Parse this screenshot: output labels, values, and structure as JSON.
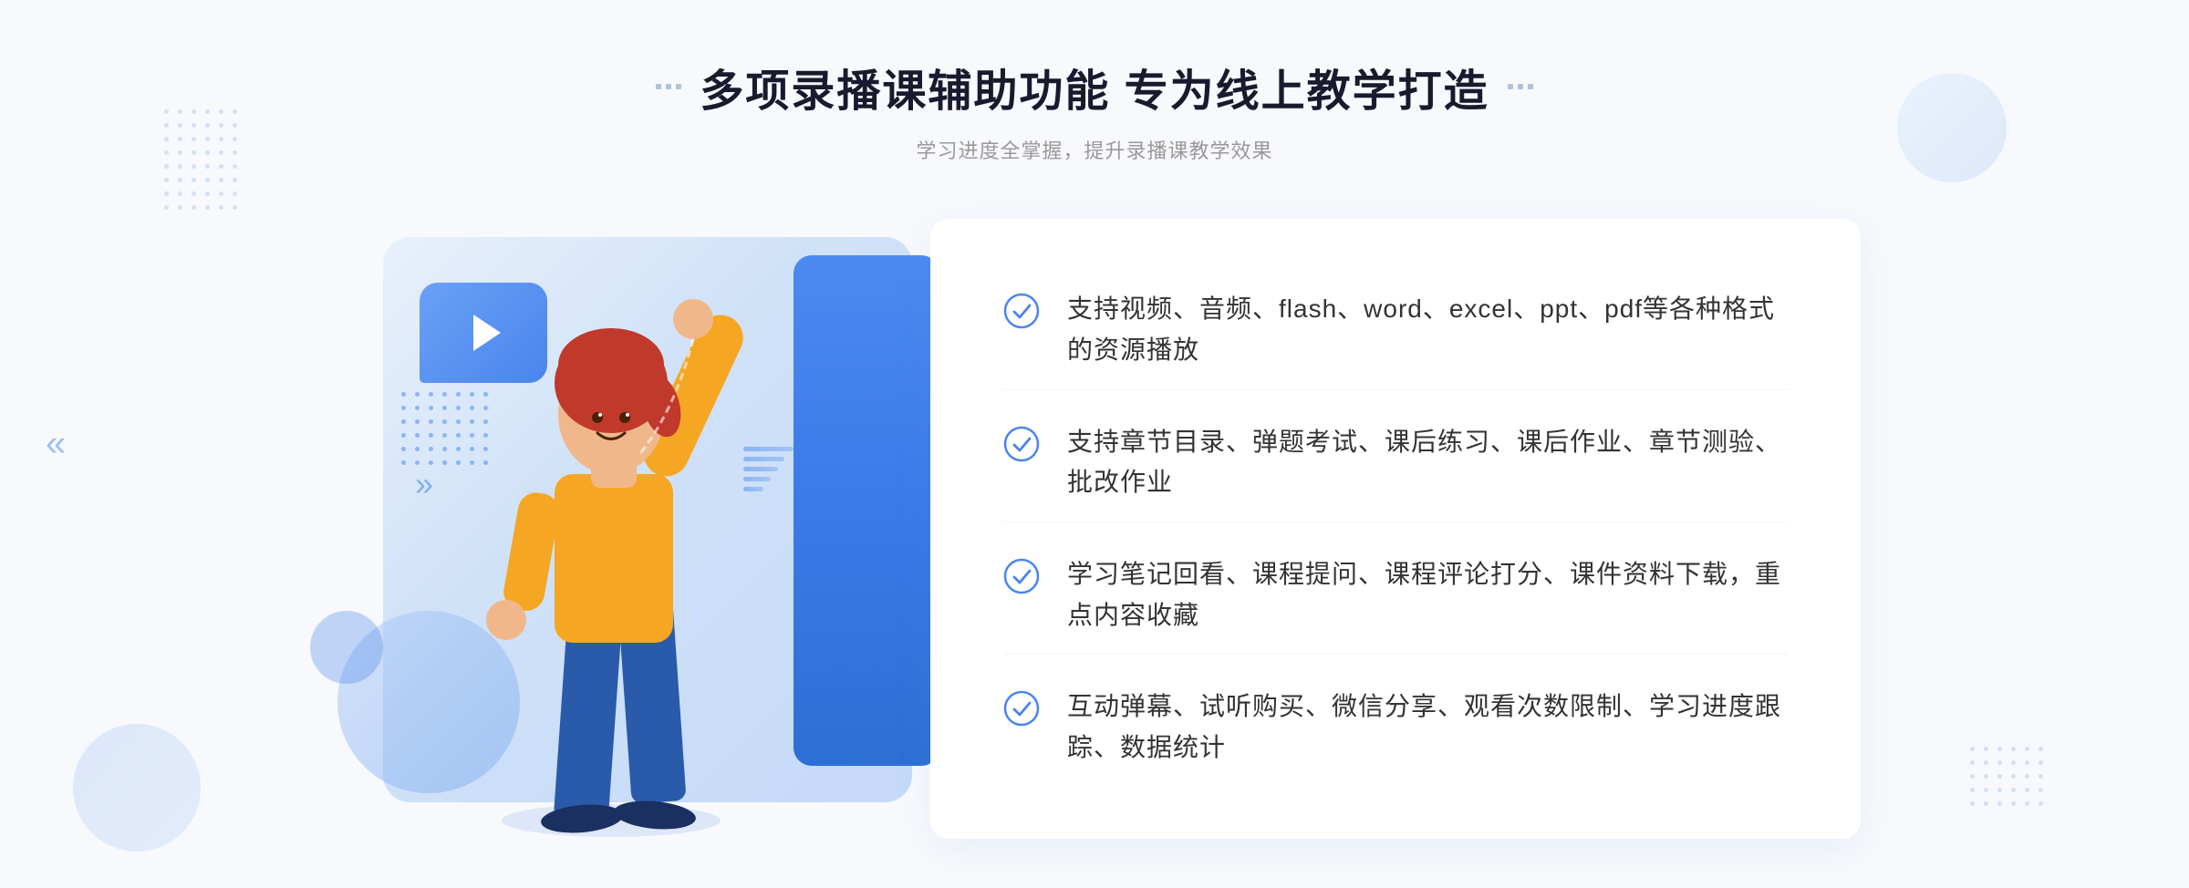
{
  "page": {
    "background": "#f7f9fc"
  },
  "header": {
    "title": "多项录播课辅助功能 专为线上教学打造",
    "subtitle": "学习进度全掌握，提升录播课教学效果"
  },
  "features": [
    {
      "id": "feature-1",
      "text": "支持视频、音频、flash、word、excel、ppt、pdf等各种格式的资源播放"
    },
    {
      "id": "feature-2",
      "text": "支持章节目录、弹题考试、课后练习、课后作业、章节测验、批改作业"
    },
    {
      "id": "feature-3",
      "text": "学习笔记回看、课程提问、课程评论打分、课件资料下载，重点内容收藏"
    },
    {
      "id": "feature-4",
      "text": "互动弹幕、试听购买、微信分享、观看次数限制、学习进度跟踪、数据统计"
    }
  ],
  "icons": {
    "check": "✓",
    "play": "▶",
    "chevron_left": "«"
  }
}
